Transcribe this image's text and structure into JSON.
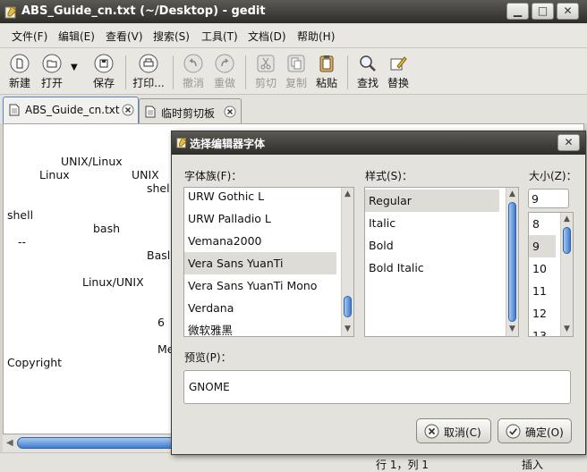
{
  "window": {
    "title": "ABS_Guide_cn.txt (~/Desktop) - gedit"
  },
  "menu": [
    "文件(F)",
    "编辑(E)",
    "查看(V)",
    "搜索(S)",
    "工具(T)",
    "文档(D)",
    "帮助(H)"
  ],
  "toolbar": {
    "new": "新建",
    "open": "打开",
    "save": "保存",
    "print": "打印...",
    "undo": "撤消",
    "redo": "重做",
    "cut": "剪切",
    "copy": "复制",
    "paste": "粘贴",
    "find": "查找",
    "replace": "替换"
  },
  "tabs": [
    {
      "label": "ABS_Guide_cn.txt"
    },
    {
      "label": "临时剪切板"
    }
  ],
  "editor_fragments": [
    "UNIX/Linux",
    "Linux",
    "UNIX",
    "shel",
    "shell",
    "bash",
    "--",
    "Basl",
    "Linux/UNIX",
    "6",
    "Me",
    "Copyright"
  ],
  "status": {
    "position": "行 1，列 1",
    "mode": "插入"
  },
  "dialog": {
    "title": "选择编辑器字体",
    "family_label": "字体族(F)：",
    "style_label": "样式(S)：",
    "size_label": "大小(Z)：",
    "families": [
      "URW Gothic L",
      "URW Palladio L",
      "Vemana2000",
      "Vera Sans YuanTi",
      "Vera Sans YuanTi Mono",
      "Verdana",
      "微软雅黑"
    ],
    "selected_family": "Vera Sans YuanTi",
    "styles": [
      "Regular",
      "Italic",
      "Bold",
      "Bold Italic"
    ],
    "selected_style": "Regular",
    "size_value": "9",
    "sizes": [
      "8",
      "9",
      "10",
      "11",
      "12",
      "13"
    ],
    "selected_size": "9",
    "preview_label": "预览(P)：",
    "preview_text": "GNOME",
    "cancel": "取消(C)",
    "ok": "确定(O)"
  }
}
